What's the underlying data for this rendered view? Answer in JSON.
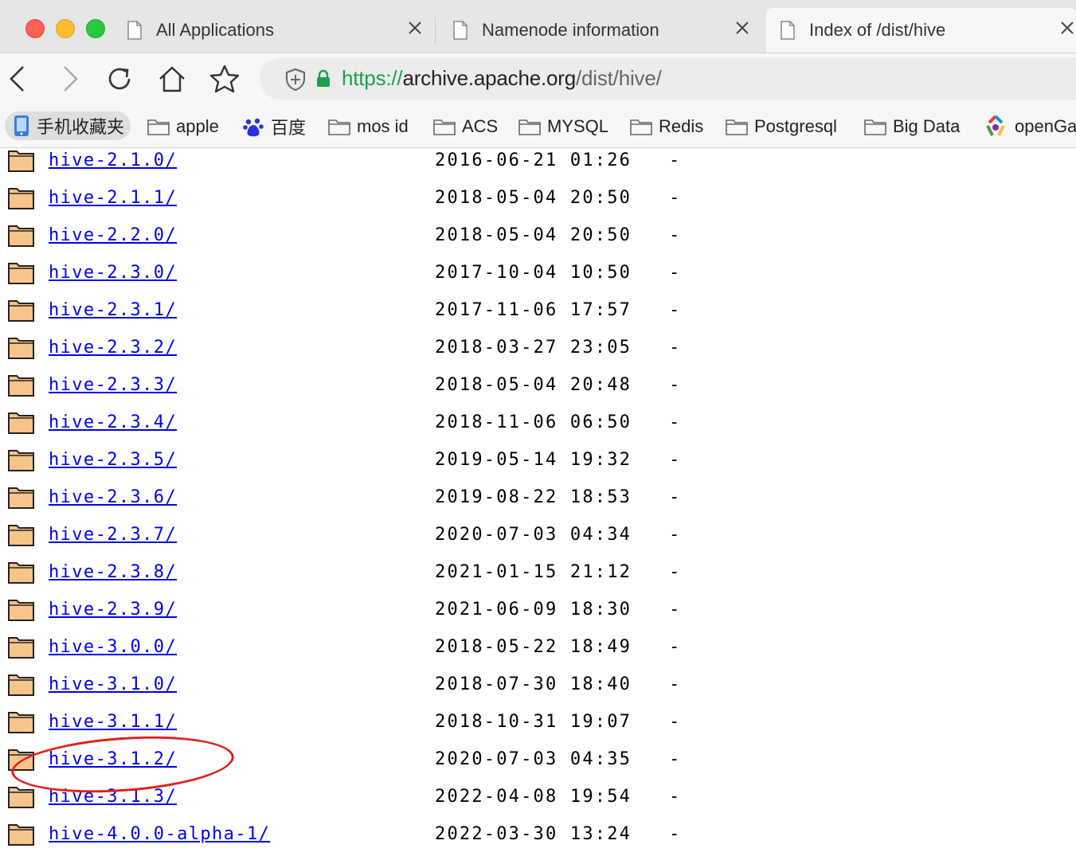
{
  "tabs": [
    {
      "title": "All Applications"
    },
    {
      "title": "Namenode information"
    },
    {
      "title": "Index of /dist/hive"
    }
  ],
  "url": {
    "scheme": "https://",
    "host": "archive.apache.org",
    "path": "/dist/hive/"
  },
  "bookmarks": [
    "手机收藏夹",
    "apple",
    "百度",
    "mos id",
    "ACS",
    "MYSQL",
    "Redis",
    "Postgresql",
    "Big Data",
    "openGa"
  ],
  "listing": [
    {
      "name": "hive-2.1.0/",
      "date": "2016-06-21 01:26",
      "size": "-"
    },
    {
      "name": "hive-2.1.1/",
      "date": "2018-05-04 20:50",
      "size": "-"
    },
    {
      "name": "hive-2.2.0/",
      "date": "2018-05-04 20:50",
      "size": "-"
    },
    {
      "name": "hive-2.3.0/",
      "date": "2017-10-04 10:50",
      "size": "-"
    },
    {
      "name": "hive-2.3.1/",
      "date": "2017-11-06 17:57",
      "size": "-"
    },
    {
      "name": "hive-2.3.2/",
      "date": "2018-03-27 23:05",
      "size": "-"
    },
    {
      "name": "hive-2.3.3/",
      "date": "2018-05-04 20:48",
      "size": "-"
    },
    {
      "name": "hive-2.3.4/",
      "date": "2018-11-06 06:50",
      "size": "-"
    },
    {
      "name": "hive-2.3.5/",
      "date": "2019-05-14 19:32",
      "size": "-"
    },
    {
      "name": "hive-2.3.6/",
      "date": "2019-08-22 18:53",
      "size": "-"
    },
    {
      "name": "hive-2.3.7/",
      "date": "2020-07-03 04:34",
      "size": "-"
    },
    {
      "name": "hive-2.3.8/",
      "date": "2021-01-15 21:12",
      "size": "-"
    },
    {
      "name": "hive-2.3.9/",
      "date": "2021-06-09 18:30",
      "size": "-"
    },
    {
      "name": "hive-3.0.0/",
      "date": "2018-05-22 18:49",
      "size": "-"
    },
    {
      "name": "hive-3.1.0/",
      "date": "2018-07-30 18:40",
      "size": "-"
    },
    {
      "name": "hive-3.1.1/",
      "date": "2018-10-31 19:07",
      "size": "-"
    },
    {
      "name": "hive-3.1.2/",
      "date": "2020-07-03 04:35",
      "size": "-"
    },
    {
      "name": "hive-3.1.3/",
      "date": "2022-04-08 19:54",
      "size": "-"
    },
    {
      "name": "hive-4.0.0-alpha-1/",
      "date": "2022-03-30 13:24",
      "size": "-"
    },
    {
      "name": "",
      "date": "",
      "size": ""
    }
  ],
  "colors": {
    "link": "#0000ee",
    "secure": "#1aa24a",
    "annotation": "#e0201c",
    "folder_fill": "#f7c48c"
  },
  "icons": [
    "back-icon",
    "forward-icon",
    "reload-icon",
    "home-icon",
    "star-icon",
    "shield-icon",
    "lock-icon",
    "folder-icon",
    "document-icon",
    "close-icon"
  ]
}
